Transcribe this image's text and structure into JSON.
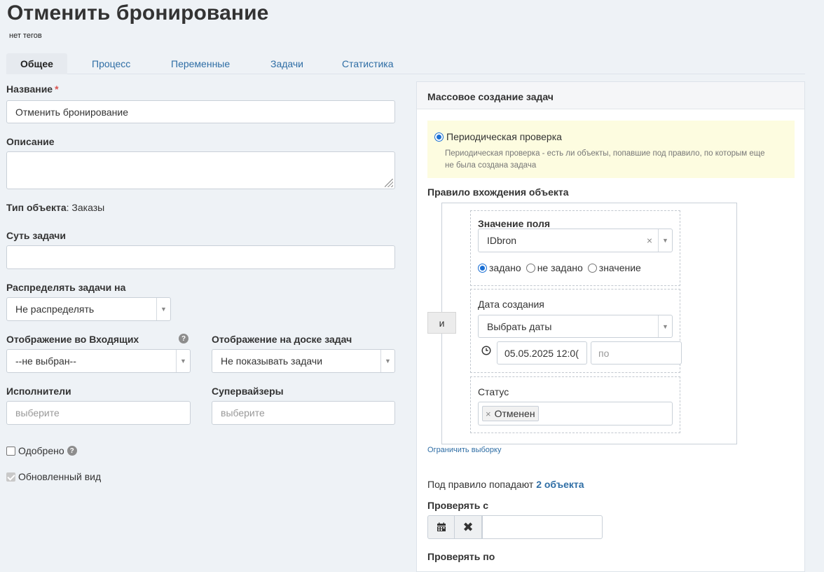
{
  "header": {
    "title": "Отменить бронирование",
    "tags": "нет тегов"
  },
  "tabs": [
    {
      "label": "Общее",
      "active": true
    },
    {
      "label": "Процесс"
    },
    {
      "label": "Переменные"
    },
    {
      "label": "Задачи"
    },
    {
      "label": "Статистика"
    }
  ],
  "form": {
    "name_label": "Название",
    "required_mark": "*",
    "name_value": "Отменить бронирование",
    "description_label": "Описание",
    "object_type_label": "Тип объекта",
    "object_type_value": ": Заказы",
    "essence_label": "Суть задачи",
    "distribute_label": "Распределять задачи на",
    "distribute_value": "Не распределять",
    "inbox_label": "Отображение во Входящих",
    "inbox_value": "--не выбран--",
    "board_label": "Отображение на доске задач",
    "board_value": "Не показывать задачи",
    "executors_label": "Исполнители",
    "executors_placeholder": "выберите",
    "supervisors_label": "Супервайзеры",
    "supervisors_placeholder": "выберите",
    "approved_label": "Одобрено",
    "updated_view_label": "Обновленный вид"
  },
  "panel": {
    "title": "Массовое создание задач",
    "periodic_label": "Периодическая проверка",
    "periodic_desc_1": "Периодическая проверка - есть ли объекты, попавшие под правило, по которым еще",
    "periodic_desc_2": "не была создана задача",
    "rule_label": "Правило вхождения объекта",
    "and_label": "и",
    "field_value_label": "Значение поля",
    "field_value_select": "IDbron",
    "clear_x": "×",
    "radio_set": "задано",
    "radio_not_set": "не задано",
    "radio_value": "значение",
    "created_date_label": "Дата создания",
    "created_date_select": "Выбрать даты",
    "date_from": "05.05.2025 12:0(",
    "date_to_placeholder": "по",
    "status_label": "Статус",
    "status_chip": "Отменен",
    "limit_link": "Ограничить выборку",
    "rule_count_prefix": "Под правило попадают",
    "rule_count_link": "2 объекта",
    "check_from_label": "Проверять с",
    "check_to_label": "Проверять по"
  }
}
